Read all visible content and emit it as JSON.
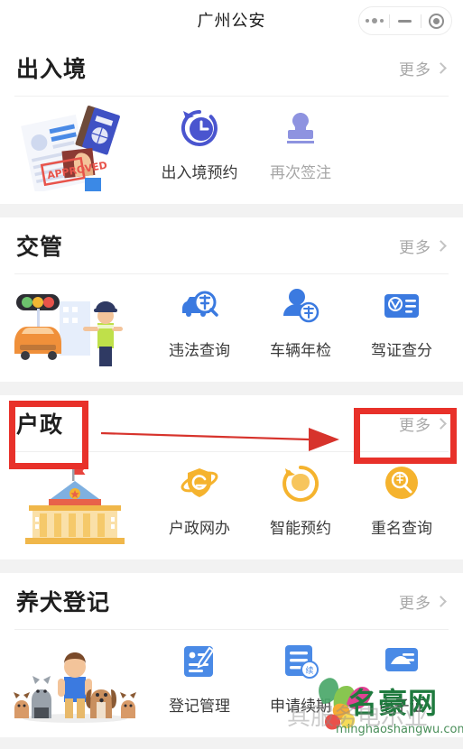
{
  "header": {
    "title": "广州公安",
    "capsule": {
      "menu_icon": "more-dots-icon",
      "minimize_icon": "minimize-icon",
      "close_icon": "target-circle-icon"
    }
  },
  "more_label": "更多",
  "sections": [
    {
      "title": "出入境",
      "illustration": "passport-documents-illustration",
      "tiles": [
        {
          "label": "出入境预约",
          "icon": "clock-refresh-icon",
          "color": "#4a55cf",
          "muted": false
        },
        {
          "label": "再次签注",
          "icon": "stamp-icon",
          "color": "#8e93e0",
          "muted": true
        }
      ]
    },
    {
      "title": "交管",
      "illustration": "traffic-police-car-illustration",
      "tiles": [
        {
          "label": "违法查询",
          "icon": "car-search-icon",
          "color": "#3b7ae0",
          "muted": false
        },
        {
          "label": "车辆年检",
          "icon": "person-year-icon",
          "color": "#3b7ae0",
          "muted": false
        },
        {
          "label": "驾证查分",
          "icon": "license-card-icon",
          "color": "#3b7ae0",
          "muted": false
        }
      ]
    },
    {
      "title": "户政",
      "illustration": "government-building-illustration",
      "tiles": [
        {
          "label": "户政网办",
          "icon": "e-globe-shield-icon",
          "color": "#f5b32e",
          "muted": false
        },
        {
          "label": "智能预约",
          "icon": "refresh-circle-icon",
          "color": "#f5b32e",
          "muted": false
        },
        {
          "label": "重名查询",
          "icon": "name-search-icon",
          "color": "#f5b32e",
          "muted": false
        }
      ]
    },
    {
      "title": "养犬登记",
      "illustration": "person-with-dogs-illustration",
      "tiles": [
        {
          "label": "登记管理",
          "icon": "document-edit-icon",
          "color": "#4a8ae6",
          "muted": false
        },
        {
          "label": "申请续期",
          "icon": "document-renew-icon",
          "color": "#4a8ae6",
          "muted": false
        },
        {
          "label": "电子证",
          "icon": "document-certificate-icon",
          "color": "#4a8ae6",
          "muted": false
        }
      ]
    }
  ],
  "annotations": {
    "box_title": "户政",
    "box_more": "更多",
    "arrow": "red-arrow-right",
    "color": "#e8312a"
  },
  "watermark": {
    "name": "名豪网",
    "url": "minghaoshangwu.com",
    "ghost": "其服务电示业"
  }
}
